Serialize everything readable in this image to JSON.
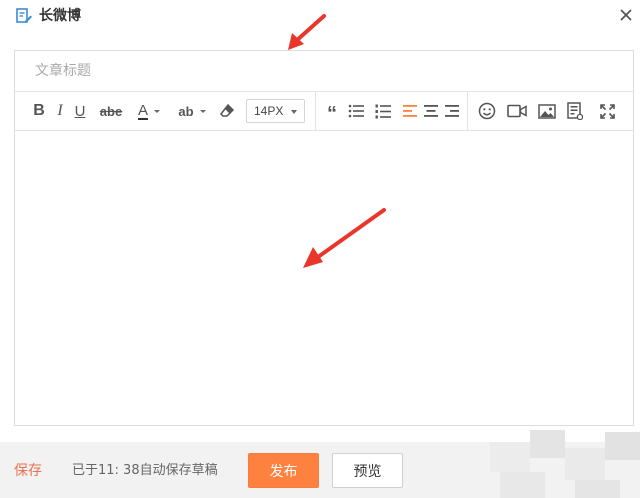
{
  "header": {
    "title": "长微博",
    "doc_icon": "edit-document-icon",
    "close_icon": "close-icon"
  },
  "editor": {
    "title_placeholder": "文章标题",
    "title_value": "",
    "content_value": "",
    "font_size": "14PX",
    "toolbar": [
      {
        "name": "bold-icon",
        "label": "B"
      },
      {
        "name": "italic-icon",
        "label": "I"
      },
      {
        "name": "underline-icon",
        "label": "U"
      },
      {
        "name": "strikethrough-icon",
        "label": "abe"
      },
      {
        "name": "font-color-icon",
        "label": "A"
      },
      {
        "name": "highlight-icon",
        "label": "ab"
      },
      {
        "name": "eraser-icon"
      },
      {
        "name": "quote-icon",
        "label": "“"
      },
      {
        "name": "bullet-list-icon"
      },
      {
        "name": "numbered-list-icon"
      },
      {
        "name": "align-left-icon",
        "active": true
      },
      {
        "name": "align-center-icon"
      },
      {
        "name": "align-right-icon"
      },
      {
        "name": "emoji-icon"
      },
      {
        "name": "video-icon"
      },
      {
        "name": "image-icon"
      },
      {
        "name": "article-card-icon"
      },
      {
        "name": "fullscreen-icon"
      }
    ]
  },
  "footer": {
    "save_label": "保存",
    "autosave_text": "已于11: 38自动保存草稿",
    "publish_label": "发布",
    "preview_label": "预览"
  },
  "colors": {
    "accent": "#ff8140",
    "save_link": "#eb7350",
    "active_align": "#ff8140",
    "annotation_arrow": "#e8362a"
  }
}
